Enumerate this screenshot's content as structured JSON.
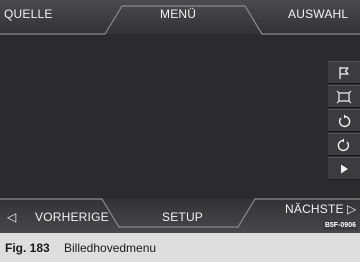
{
  "top_bar": {
    "left_tab": "QUELLE",
    "center_tab": "MENÜ",
    "right_tab": "AUSWAHL"
  },
  "bottom_bar": {
    "left_arrow": "◁",
    "left_tab": "VORHERIGE",
    "center_tab": "SETUP",
    "right_tab": "NÄCHSTE",
    "right_arrow": "▷"
  },
  "side_toolbar": {
    "buttons": [
      {
        "icon": "flag-icon"
      },
      {
        "icon": "fit-frame-icon"
      },
      {
        "icon": "rotate-left-icon"
      },
      {
        "icon": "rotate-right-icon"
      },
      {
        "icon": "play-icon"
      }
    ]
  },
  "image_code": "B5F-0906",
  "caption": {
    "number": "Fig. 183",
    "title": "Billedhovedmenu"
  },
  "colors": {
    "screen_bg": "#2b2b2d",
    "bar_bg": "#404043",
    "bar_line": "#6a6a6d",
    "text": "#f2f2f2",
    "caption_bg": "#dedede"
  }
}
